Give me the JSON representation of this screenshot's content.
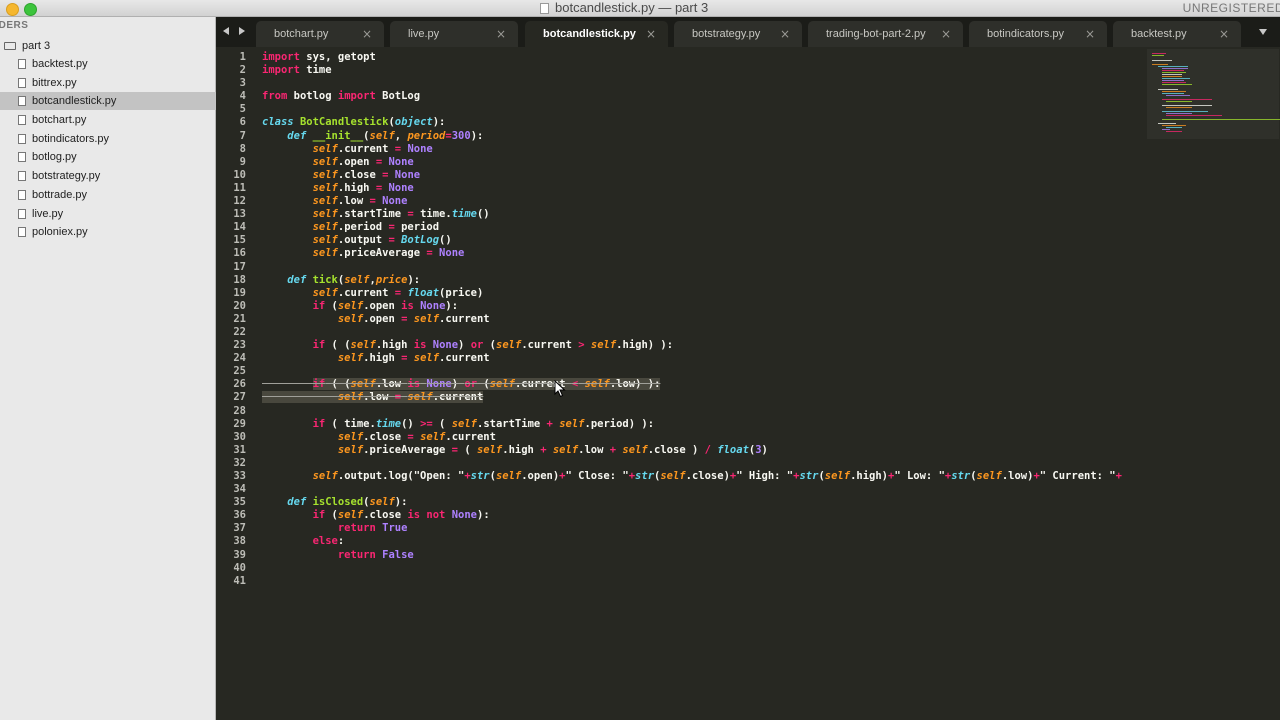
{
  "window": {
    "title": "botcandlestick.py — part 3",
    "unregistered": "UNREGISTERED"
  },
  "sidebar": {
    "header": "LDERS",
    "folder": "part 3",
    "files": [
      "backtest.py",
      "bittrex.py",
      "botcandlestick.py",
      "botchart.py",
      "botindicators.py",
      "botlog.py",
      "botstrategy.py",
      "bottrade.py",
      "live.py",
      "poloniex.py"
    ],
    "selected_index": 2
  },
  "tabs": [
    {
      "label": "botchart.py",
      "active": false
    },
    {
      "label": "live.py",
      "active": false
    },
    {
      "label": "botcandlestick.py",
      "active": true
    },
    {
      "label": "botstrategy.py",
      "active": false
    },
    {
      "label": "trading-bot-part-2.py",
      "active": false
    },
    {
      "label": "botindicators.py",
      "active": false
    },
    {
      "label": "backtest.py",
      "active": false
    }
  ],
  "tab_close_glyph": "×",
  "editor": {
    "line_numbers": [
      "1",
      "2",
      "3",
      "4",
      "5",
      "6",
      "7",
      "8",
      "9",
      "10",
      "11",
      "12",
      "13",
      "14",
      "15",
      "16",
      "17",
      "18",
      "19",
      "20",
      "21",
      "22",
      "23",
      "24",
      "25",
      "26",
      "27",
      "28",
      "29",
      "30",
      "31",
      "32",
      "33",
      "34",
      "35",
      "36",
      "37",
      "38",
      "39",
      "40",
      "41"
    ],
    "lines": [
      [
        [
          "k",
          "import"
        ],
        [
          "t",
          " sys, getopt"
        ]
      ],
      [
        [
          "k",
          "import"
        ],
        [
          "t",
          " time"
        ]
      ],
      [],
      [
        [
          "k",
          "from"
        ],
        [
          "t",
          " botlog "
        ],
        [
          "k",
          "import"
        ],
        [
          "t",
          " BotLog"
        ]
      ],
      [],
      [
        [
          "d",
          "class"
        ],
        [
          "t",
          " "
        ],
        [
          "c",
          "BotCandlestick"
        ],
        [
          "t",
          "("
        ],
        [
          "d",
          "object"
        ],
        [
          "t",
          "):"
        ]
      ],
      [
        [
          "t",
          "    "
        ],
        [
          "d",
          "def"
        ],
        [
          "t",
          " "
        ],
        [
          "c",
          "__init__"
        ],
        [
          "t",
          "("
        ],
        [
          "s",
          "self"
        ],
        [
          "t",
          ", "
        ],
        [
          "s",
          "period"
        ],
        [
          "k",
          "="
        ],
        [
          "p",
          "300"
        ],
        [
          "t",
          "):"
        ]
      ],
      [
        [
          "t",
          "        "
        ],
        [
          "s",
          "self"
        ],
        [
          "t",
          ".current "
        ],
        [
          "k",
          "="
        ],
        [
          "t",
          " "
        ],
        [
          "p",
          "None"
        ]
      ],
      [
        [
          "t",
          "        "
        ],
        [
          "s",
          "self"
        ],
        [
          "t",
          ".open "
        ],
        [
          "k",
          "="
        ],
        [
          "t",
          " "
        ],
        [
          "p",
          "None"
        ]
      ],
      [
        [
          "t",
          "        "
        ],
        [
          "s",
          "self"
        ],
        [
          "t",
          ".close "
        ],
        [
          "k",
          "="
        ],
        [
          "t",
          " "
        ],
        [
          "p",
          "None"
        ]
      ],
      [
        [
          "t",
          "        "
        ],
        [
          "s",
          "self"
        ],
        [
          "t",
          ".high "
        ],
        [
          "k",
          "="
        ],
        [
          "t",
          " "
        ],
        [
          "p",
          "None"
        ]
      ],
      [
        [
          "t",
          "        "
        ],
        [
          "s",
          "self"
        ],
        [
          "t",
          ".low "
        ],
        [
          "k",
          "="
        ],
        [
          "t",
          " "
        ],
        [
          "p",
          "None"
        ]
      ],
      [
        [
          "t",
          "        "
        ],
        [
          "s",
          "self"
        ],
        [
          "t",
          ".startTime "
        ],
        [
          "k",
          "="
        ],
        [
          "t",
          " time."
        ],
        [
          "d",
          "time"
        ],
        [
          "t",
          "()"
        ]
      ],
      [
        [
          "t",
          "        "
        ],
        [
          "s",
          "self"
        ],
        [
          "t",
          ".period "
        ],
        [
          "k",
          "="
        ],
        [
          "t",
          " period"
        ]
      ],
      [
        [
          "t",
          "        "
        ],
        [
          "s",
          "self"
        ],
        [
          "t",
          ".output "
        ],
        [
          "k",
          "="
        ],
        [
          "t",
          " "
        ],
        [
          "d",
          "BotLog"
        ],
        [
          "t",
          "()"
        ]
      ],
      [
        [
          "t",
          "        "
        ],
        [
          "s",
          "self"
        ],
        [
          "t",
          ".priceAverage "
        ],
        [
          "k",
          "="
        ],
        [
          "t",
          " "
        ],
        [
          "p",
          "None"
        ]
      ],
      [],
      [
        [
          "t",
          "    "
        ],
        [
          "d",
          "def"
        ],
        [
          "t",
          " "
        ],
        [
          "c",
          "tick"
        ],
        [
          "t",
          "("
        ],
        [
          "s",
          "self"
        ],
        [
          "t",
          ","
        ],
        [
          "s",
          "price"
        ],
        [
          "t",
          "):"
        ]
      ],
      [
        [
          "t",
          "        "
        ],
        [
          "s",
          "self"
        ],
        [
          "t",
          ".current "
        ],
        [
          "k",
          "="
        ],
        [
          "t",
          " "
        ],
        [
          "d",
          "float"
        ],
        [
          "t",
          "(price)"
        ]
      ],
      [
        [
          "t",
          "        "
        ],
        [
          "k",
          "if"
        ],
        [
          "t",
          " ("
        ],
        [
          "s",
          "self"
        ],
        [
          "t",
          ".open "
        ],
        [
          "k",
          "is"
        ],
        [
          "t",
          " "
        ],
        [
          "p",
          "None"
        ],
        [
          "t",
          "):"
        ]
      ],
      [
        [
          "t",
          "            "
        ],
        [
          "s",
          "self"
        ],
        [
          "t",
          ".open "
        ],
        [
          "k",
          "="
        ],
        [
          "t",
          " "
        ],
        [
          "s",
          "self"
        ],
        [
          "t",
          ".current"
        ]
      ],
      [],
      [
        [
          "t",
          "        "
        ],
        [
          "k",
          "if"
        ],
        [
          "t",
          " ( ("
        ],
        [
          "s",
          "self"
        ],
        [
          "t",
          ".high "
        ],
        [
          "k",
          "is"
        ],
        [
          "t",
          " "
        ],
        [
          "p",
          "None"
        ],
        [
          "t",
          ") "
        ],
        [
          "k",
          "or"
        ],
        [
          "t",
          " ("
        ],
        [
          "s",
          "self"
        ],
        [
          "t",
          ".current "
        ],
        [
          "k",
          ">"
        ],
        [
          "t",
          " "
        ],
        [
          "s",
          "self"
        ],
        [
          "t",
          ".high) ):"
        ]
      ],
      [
        [
          "t",
          "            "
        ],
        [
          "s",
          "self"
        ],
        [
          "t",
          ".high "
        ],
        [
          "k",
          "="
        ],
        [
          "t",
          " "
        ],
        [
          "s",
          "self"
        ],
        [
          "t",
          ".current"
        ]
      ],
      [],
      [
        [
          "t",
          "        "
        ],
        [
          "k",
          "if"
        ],
        [
          "t",
          " ( ("
        ],
        [
          "s",
          "self"
        ],
        [
          "t",
          ".low "
        ],
        [
          "k",
          "is"
        ],
        [
          "t",
          " "
        ],
        [
          "p",
          "None"
        ],
        [
          "t",
          ") "
        ],
        [
          "k",
          "or"
        ],
        [
          "t",
          " ("
        ],
        [
          "s",
          "self"
        ],
        [
          "t",
          ".current "
        ],
        [
          "k",
          "<"
        ],
        [
          "t",
          " "
        ],
        [
          "s",
          "self"
        ],
        [
          "t",
          ".low) ):"
        ]
      ],
      [
        [
          "t",
          "            "
        ],
        [
          "s",
          "self"
        ],
        [
          "t",
          ".low "
        ],
        [
          "k",
          "="
        ],
        [
          "t",
          " "
        ],
        [
          "s",
          "self"
        ],
        [
          "t",
          ".current"
        ]
      ],
      [],
      [
        [
          "t",
          "        "
        ],
        [
          "k",
          "if"
        ],
        [
          "t",
          " ( time."
        ],
        [
          "d",
          "time"
        ],
        [
          "t",
          "() "
        ],
        [
          "k",
          ">="
        ],
        [
          "t",
          " ( "
        ],
        [
          "s",
          "self"
        ],
        [
          "t",
          ".startTime "
        ],
        [
          "k",
          "+"
        ],
        [
          "t",
          " "
        ],
        [
          "s",
          "self"
        ],
        [
          "t",
          ".period) ):"
        ]
      ],
      [
        [
          "t",
          "            "
        ],
        [
          "s",
          "self"
        ],
        [
          "t",
          ".close "
        ],
        [
          "k",
          "="
        ],
        [
          "t",
          " "
        ],
        [
          "s",
          "self"
        ],
        [
          "t",
          ".current"
        ]
      ],
      [
        [
          "t",
          "            "
        ],
        [
          "s",
          "self"
        ],
        [
          "t",
          ".priceAverage "
        ],
        [
          "k",
          "="
        ],
        [
          "t",
          " ( "
        ],
        [
          "s",
          "self"
        ],
        [
          "t",
          ".high "
        ],
        [
          "k",
          "+"
        ],
        [
          "t",
          " "
        ],
        [
          "s",
          "self"
        ],
        [
          "t",
          ".low "
        ],
        [
          "k",
          "+"
        ],
        [
          "t",
          " "
        ],
        [
          "s",
          "self"
        ],
        [
          "t",
          ".close ) "
        ],
        [
          "k",
          "/"
        ],
        [
          "t",
          " "
        ],
        [
          "d",
          "float"
        ],
        [
          "t",
          "("
        ],
        [
          "p",
          "3"
        ],
        [
          "t",
          ")"
        ]
      ],
      [],
      [
        [
          "t",
          "        "
        ],
        [
          "s",
          "self"
        ],
        [
          "t",
          ".output.log(\"Open: \""
        ],
        [
          "k",
          "+"
        ],
        [
          "d",
          "str"
        ],
        [
          "t",
          "("
        ],
        [
          "s",
          "self"
        ],
        [
          "t",
          ".open)"
        ],
        [
          "k",
          "+"
        ],
        [
          "t",
          "\" Close: \""
        ],
        [
          "k",
          "+"
        ],
        [
          "d",
          "str"
        ],
        [
          "t",
          "("
        ],
        [
          "s",
          "self"
        ],
        [
          "t",
          ".close)"
        ],
        [
          "k",
          "+"
        ],
        [
          "t",
          "\" High: \""
        ],
        [
          "k",
          "+"
        ],
        [
          "d",
          "str"
        ],
        [
          "t",
          "("
        ],
        [
          "s",
          "self"
        ],
        [
          "t",
          ".high)"
        ],
        [
          "k",
          "+"
        ],
        [
          "t",
          "\" Low: \""
        ],
        [
          "k",
          "+"
        ],
        [
          "d",
          "str"
        ],
        [
          "t",
          "("
        ],
        [
          "s",
          "self"
        ],
        [
          "t",
          ".low)"
        ],
        [
          "k",
          "+"
        ],
        [
          "t",
          "\" Current: \""
        ],
        [
          "k",
          "+"
        ]
      ],
      [],
      [
        [
          "t",
          "    "
        ],
        [
          "d",
          "def"
        ],
        [
          "t",
          " "
        ],
        [
          "c",
          "isClosed"
        ],
        [
          "t",
          "("
        ],
        [
          "s",
          "self"
        ],
        [
          "t",
          "):"
        ]
      ],
      [
        [
          "t",
          "        "
        ],
        [
          "k",
          "if"
        ],
        [
          "t",
          " ("
        ],
        [
          "s",
          "self"
        ],
        [
          "t",
          ".close "
        ],
        [
          "k",
          "is not"
        ],
        [
          "t",
          " "
        ],
        [
          "p",
          "None"
        ],
        [
          "t",
          "):"
        ]
      ],
      [
        [
          "t",
          "            "
        ],
        [
          "k",
          "return"
        ],
        [
          "t",
          " "
        ],
        [
          "p",
          "True"
        ]
      ],
      [
        [
          "t",
          "        "
        ],
        [
          "k",
          "else"
        ],
        [
          "t",
          ":"
        ]
      ],
      [
        [
          "t",
          "            "
        ],
        [
          "k",
          "return"
        ],
        [
          "t",
          " "
        ],
        [
          "p",
          "False"
        ]
      ],
      [],
      []
    ],
    "selected_lines": [
      26,
      27
    ]
  },
  "colors": {
    "background": "#272822",
    "keyword": "#f92672",
    "builtin": "#66d9ef",
    "name": "#a6e22e",
    "self": "#fd971f",
    "constant": "#ae81ff",
    "selection": "#49483e"
  }
}
